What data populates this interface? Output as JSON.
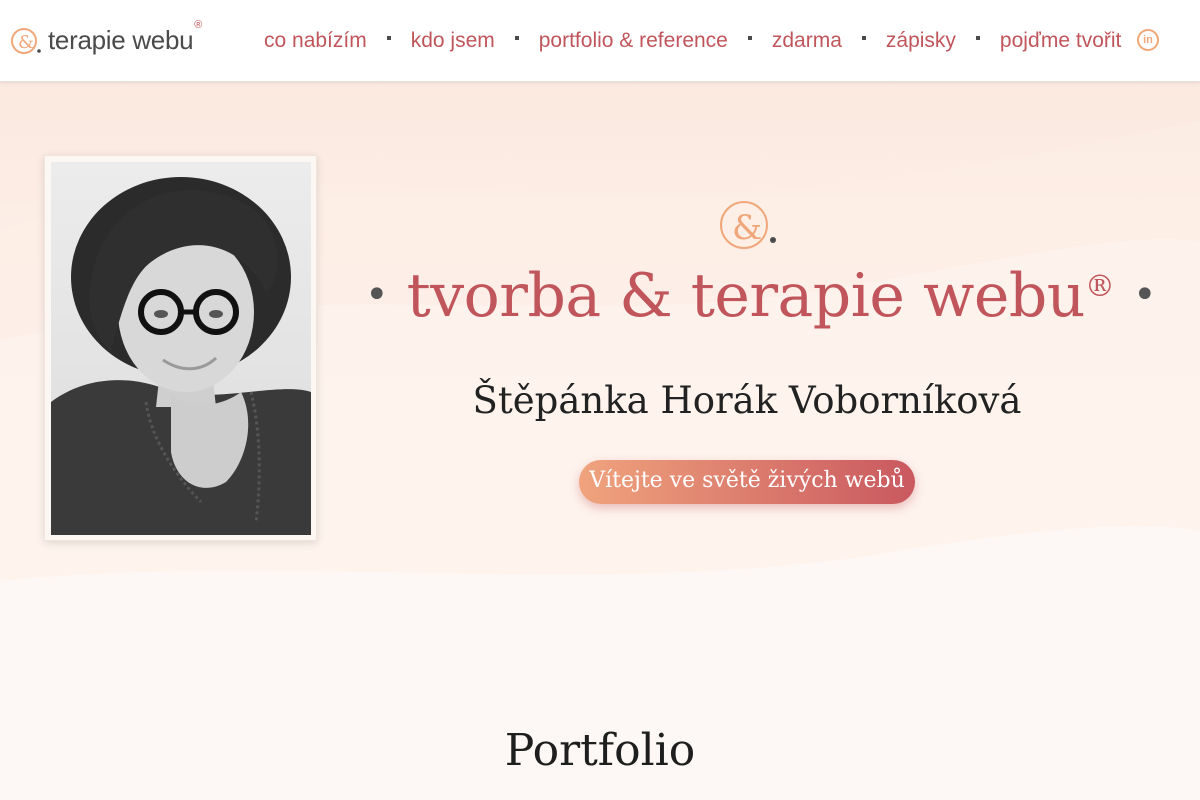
{
  "header": {
    "logo_text": "terapie webu",
    "logo_reg": "®",
    "nav": [
      {
        "label": "co nabízím"
      },
      {
        "label": "kdo jsem"
      },
      {
        "label": "portfolio & reference"
      },
      {
        "label": "zdarma"
      },
      {
        "label": "zápisky"
      },
      {
        "label": "pojďme tvořit"
      }
    ],
    "social_icon": "linkedin-icon",
    "social_label": "in"
  },
  "hero": {
    "photo_icon": "portrait-photo",
    "title": "tvorba & terapie webu",
    "title_reg": "®",
    "bullet": "•",
    "name": "Štěpánka Horák Voborníková",
    "cta_label": "Vítejte ve světě živých webů"
  },
  "portfolio": {
    "title": "Portfolio"
  },
  "colors": {
    "accent": "#c0565b",
    "accent_light": "#f0a77a",
    "text_dark": "#222222",
    "hero_bg": "#fbe9df"
  }
}
